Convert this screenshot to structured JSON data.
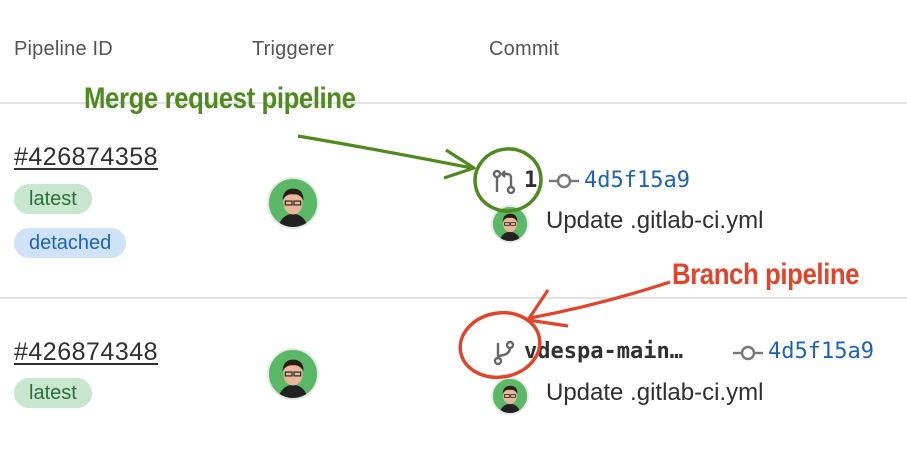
{
  "table": {
    "headers": {
      "pipeline_id": "Pipeline ID",
      "triggerer": "Triggerer",
      "commit": "Commit"
    }
  },
  "rows": [
    {
      "pipeline_id": "#426874358",
      "badges": [
        "latest",
        "detached"
      ],
      "ref_icon": "merge-request-icon",
      "ref_label": "1",
      "commit_icon": "commit-icon",
      "sha": "4d5f15a9",
      "commit_message": "Update .gitlab-ci.yml"
    },
    {
      "pipeline_id": "#426874348",
      "badges": [
        "latest"
      ],
      "ref_icon": "branch-icon",
      "ref_label": "vdespa-main…",
      "commit_icon": "commit-icon",
      "sha": "4d5f15a9",
      "commit_message": "Update .gitlab-ci.yml"
    }
  ],
  "annotations": {
    "merge_request": {
      "text": "Merge request pipeline",
      "color": "#4e8a1f"
    },
    "branch": {
      "text": "Branch pipeline",
      "color": "#e0452b"
    }
  },
  "colors": {
    "badge_green_bg": "#c9e6cf",
    "badge_blue_bg": "#cfe2f7",
    "link_blue": "#1f62b5"
  }
}
